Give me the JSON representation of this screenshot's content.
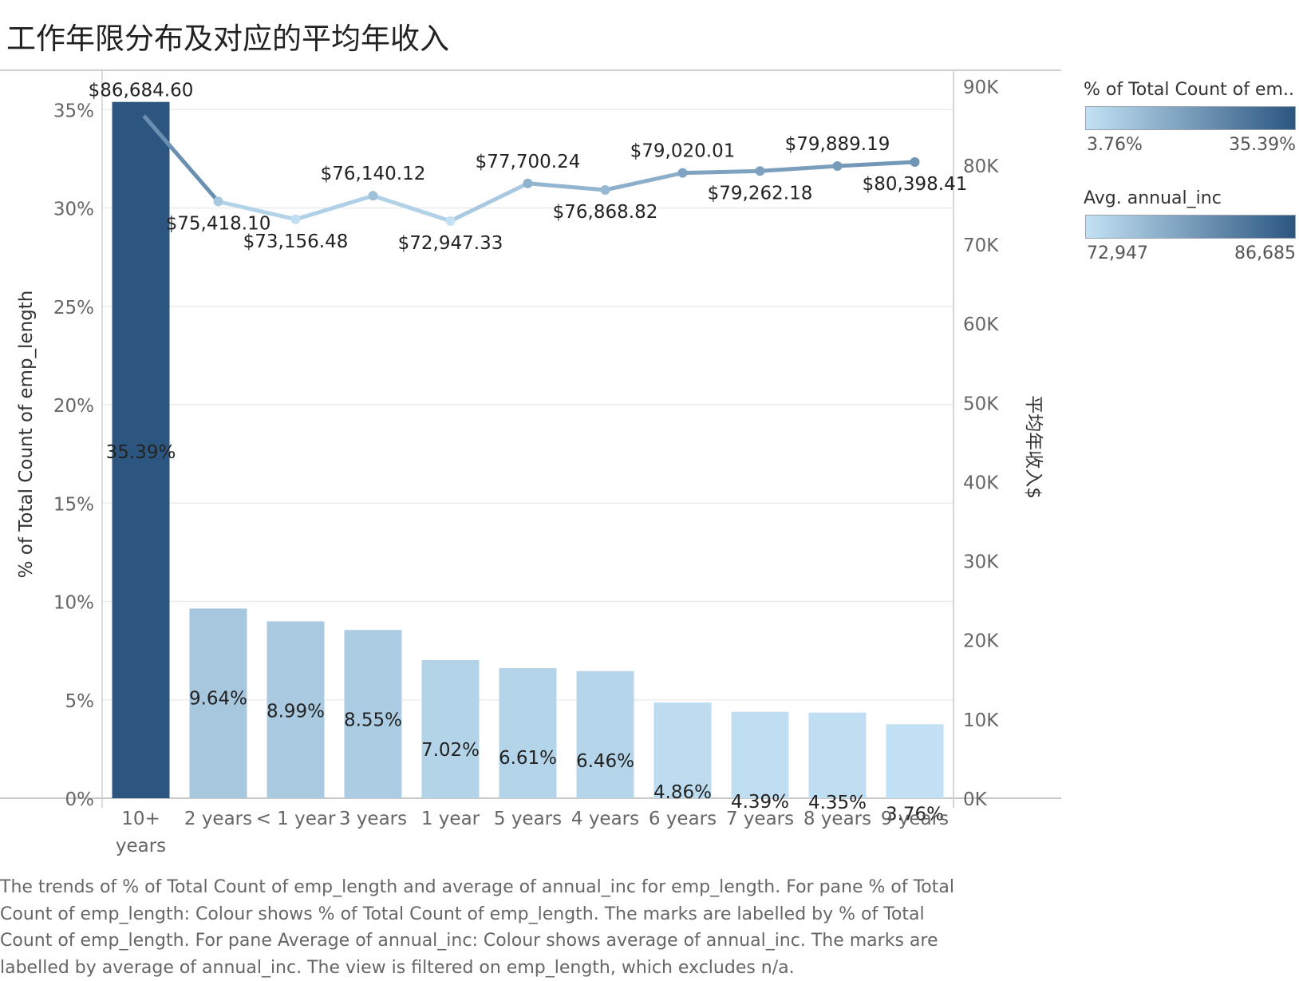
{
  "title": "工作年限分布及对应的平均年收入",
  "legends": [
    {
      "title": "% of Total Count of em..",
      "min_label": "3.76%",
      "max_label": "35.39%",
      "color_low": "#c2e1f4",
      "color_high": "#2c5680"
    },
    {
      "title": "Avg. annual_inc",
      "min_label": "72,947",
      "max_label": "86,685",
      "color_low": "#c2e1f4",
      "color_high": "#2c5680"
    }
  ],
  "caption": "The trends of % of Total Count of emp_length and average of annual_inc for emp_length.  For pane % of Total Count of emp_length:  Colour shows % of Total Count of emp_length.  The marks are labelled by % of Total Count of emp_length.  For pane Average of annual_inc:  Colour shows average of annual_inc.  The marks are labelled by average of annual_inc. The view is filtered on emp_length, which excludes n/a.",
  "chart_data": {
    "type": "bar+line",
    "categories": [
      "10+ years",
      "2 years",
      "< 1 year",
      "3 years",
      "1 year",
      "5 years",
      "4 years",
      "6 years",
      "7 years",
      "8 years",
      "9 years"
    ],
    "bar_series": {
      "values": [
        35.39,
        9.64,
        8.99,
        8.55,
        7.02,
        6.61,
        6.46,
        4.86,
        4.39,
        4.35,
        3.76
      ],
      "labels": [
        "35.39%",
        "9.64%",
        "8.99%",
        "8.55%",
        "7.02%",
        "6.61%",
        "6.46%",
        "4.86%",
        "4.39%",
        "4.35%",
        "3.76%"
      ]
    },
    "line_series": {
      "values": [
        86684.6,
        75418.1,
        73156.48,
        76140.12,
        72947.33,
        77700.24,
        76868.82,
        79020.01,
        79262.18,
        79889.19,
        80398.41
      ],
      "labels": [
        "$86,684.60",
        "$75,418.10",
        "$73,156.48",
        "$76,140.12",
        "$72,947.33",
        "$77,700.24",
        "$76,868.82",
        "$79,020.01",
        "$79,262.18",
        "$79,889.19",
        "$80,398.41"
      ],
      "label_above": [
        true,
        false,
        false,
        true,
        false,
        true,
        false,
        true,
        false,
        true,
        false
      ]
    },
    "y_left": {
      "label": "% of Total Count of emp_length",
      "range": [
        0,
        37
      ],
      "ticks": [
        "0%",
        "5%",
        "10%",
        "15%",
        "20%",
        "25%",
        "30%",
        "35%"
      ],
      "tick_values": [
        0,
        5,
        10,
        15,
        20,
        25,
        30,
        35
      ]
    },
    "y_right": {
      "label": "平均年收入$",
      "range": [
        0,
        92000
      ],
      "ticks": [
        "0K",
        "10K",
        "20K",
        "30K",
        "40K",
        "50K",
        "60K",
        "70K",
        "80K",
        "90K"
      ],
      "tick_values": [
        0,
        10000,
        20000,
        30000,
        40000,
        50000,
        60000,
        70000,
        80000,
        90000
      ]
    },
    "x_tick_labels": [
      [
        "10+",
        "years"
      ],
      [
        "2 years"
      ],
      [
        "< 1 year"
      ],
      [
        "3 years"
      ],
      [
        "1 year"
      ],
      [
        "5 years"
      ],
      [
        "4 years"
      ],
      [
        "6 years"
      ],
      [
        "7 years"
      ],
      [
        "8 years"
      ],
      [
        "9 years"
      ]
    ],
    "grid": true
  }
}
